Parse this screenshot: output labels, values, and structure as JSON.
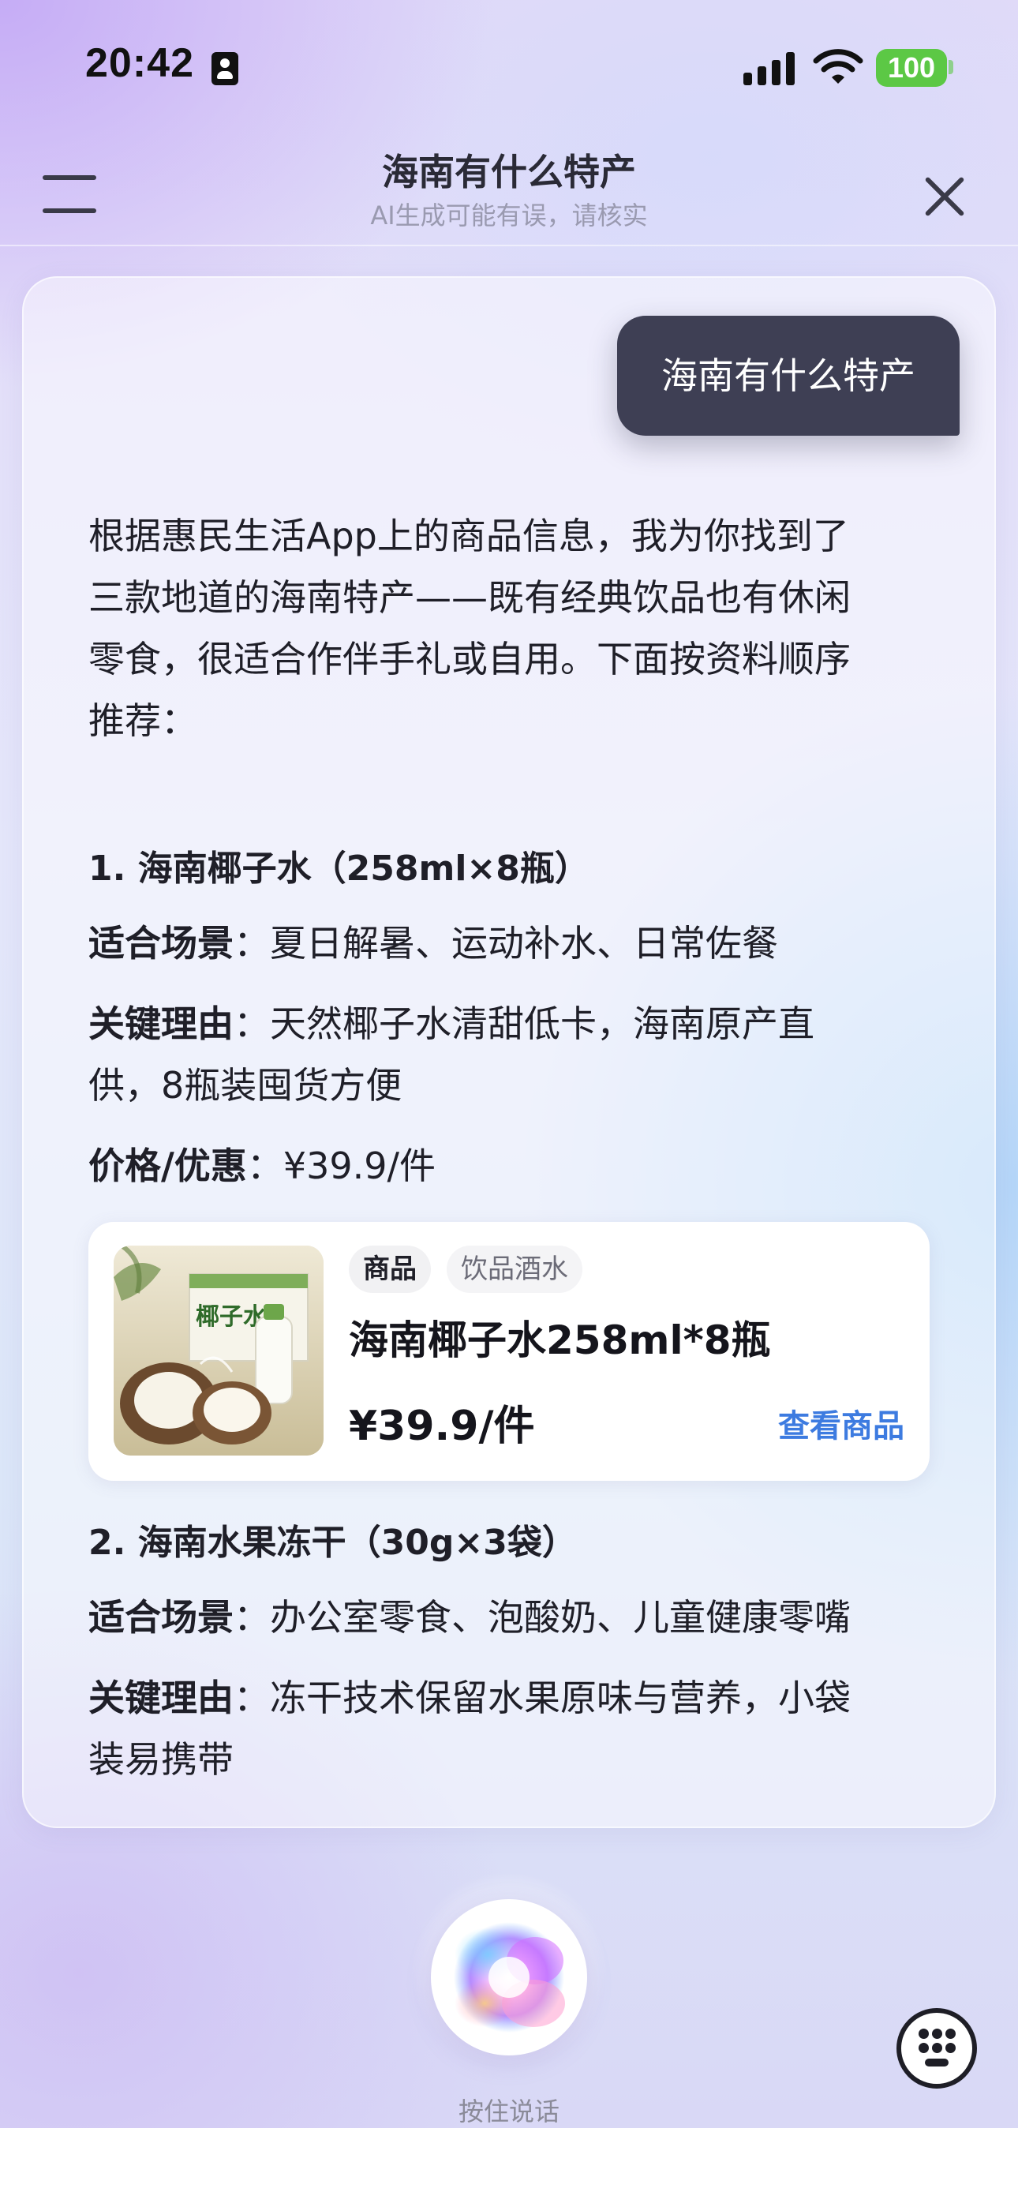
{
  "status_bar": {
    "time": "20:42",
    "battery": "100"
  },
  "header": {
    "title": "海南有什么特产",
    "subtitle": "AI生成可能有误，请核实"
  },
  "chat": {
    "user_message": "海南有什么特产",
    "answer_intro": [
      "根据惠民生活App上的商品信息，我为你找到了",
      "三款地道的海南特产——既有经典饮品也有休闲",
      "零食，很适合作伴手礼或自用。下面按资料顺序",
      "推荐："
    ],
    "items": [
      {
        "heading": "1. 海南椰子水（258ml×8瓶）",
        "scenario_key": "适合场景",
        "scenario_value": "：夏日解暑、运动补水、日常佐餐",
        "reason_key": "关键理由",
        "reason_line1": "：天然椰子水清甜低卡，海南原产直",
        "reason_line2": "供，8瓶装囤货方便",
        "price_key": "价格/优惠",
        "price_value": "：¥39.9/件"
      },
      {
        "heading": "2. 海南水果冻干（30g×3袋）",
        "scenario_key": "适合场景",
        "scenario_value": "：办公室零食、泡酸奶、儿童健康零嘴",
        "reason_key": "关键理由",
        "reason_line1": "：冻干技术保留水果原味与营养，小袋",
        "reason_line2": "装易携带"
      }
    ],
    "product_card": {
      "tag_primary": "商品",
      "tag_secondary": "饮品酒水",
      "name": "海南椰子水258ml*8瓶",
      "price": "¥39.9/件",
      "link": "查看商品",
      "image_text": "椰子水"
    }
  },
  "bottom": {
    "voice_label": "按住说话"
  },
  "icons": {
    "menu": "menu-icon",
    "close": "close-icon",
    "voice": "voice-orb-icon",
    "keyboard": "keyboard-icon",
    "signal": "signal-icon",
    "wifi": "wifi-icon",
    "battery": "battery-icon",
    "id": "person-badge-icon"
  },
  "colors": {
    "user_bubble": "#3e3f54",
    "link": "#3d7be0",
    "battery": "#5cc845"
  }
}
